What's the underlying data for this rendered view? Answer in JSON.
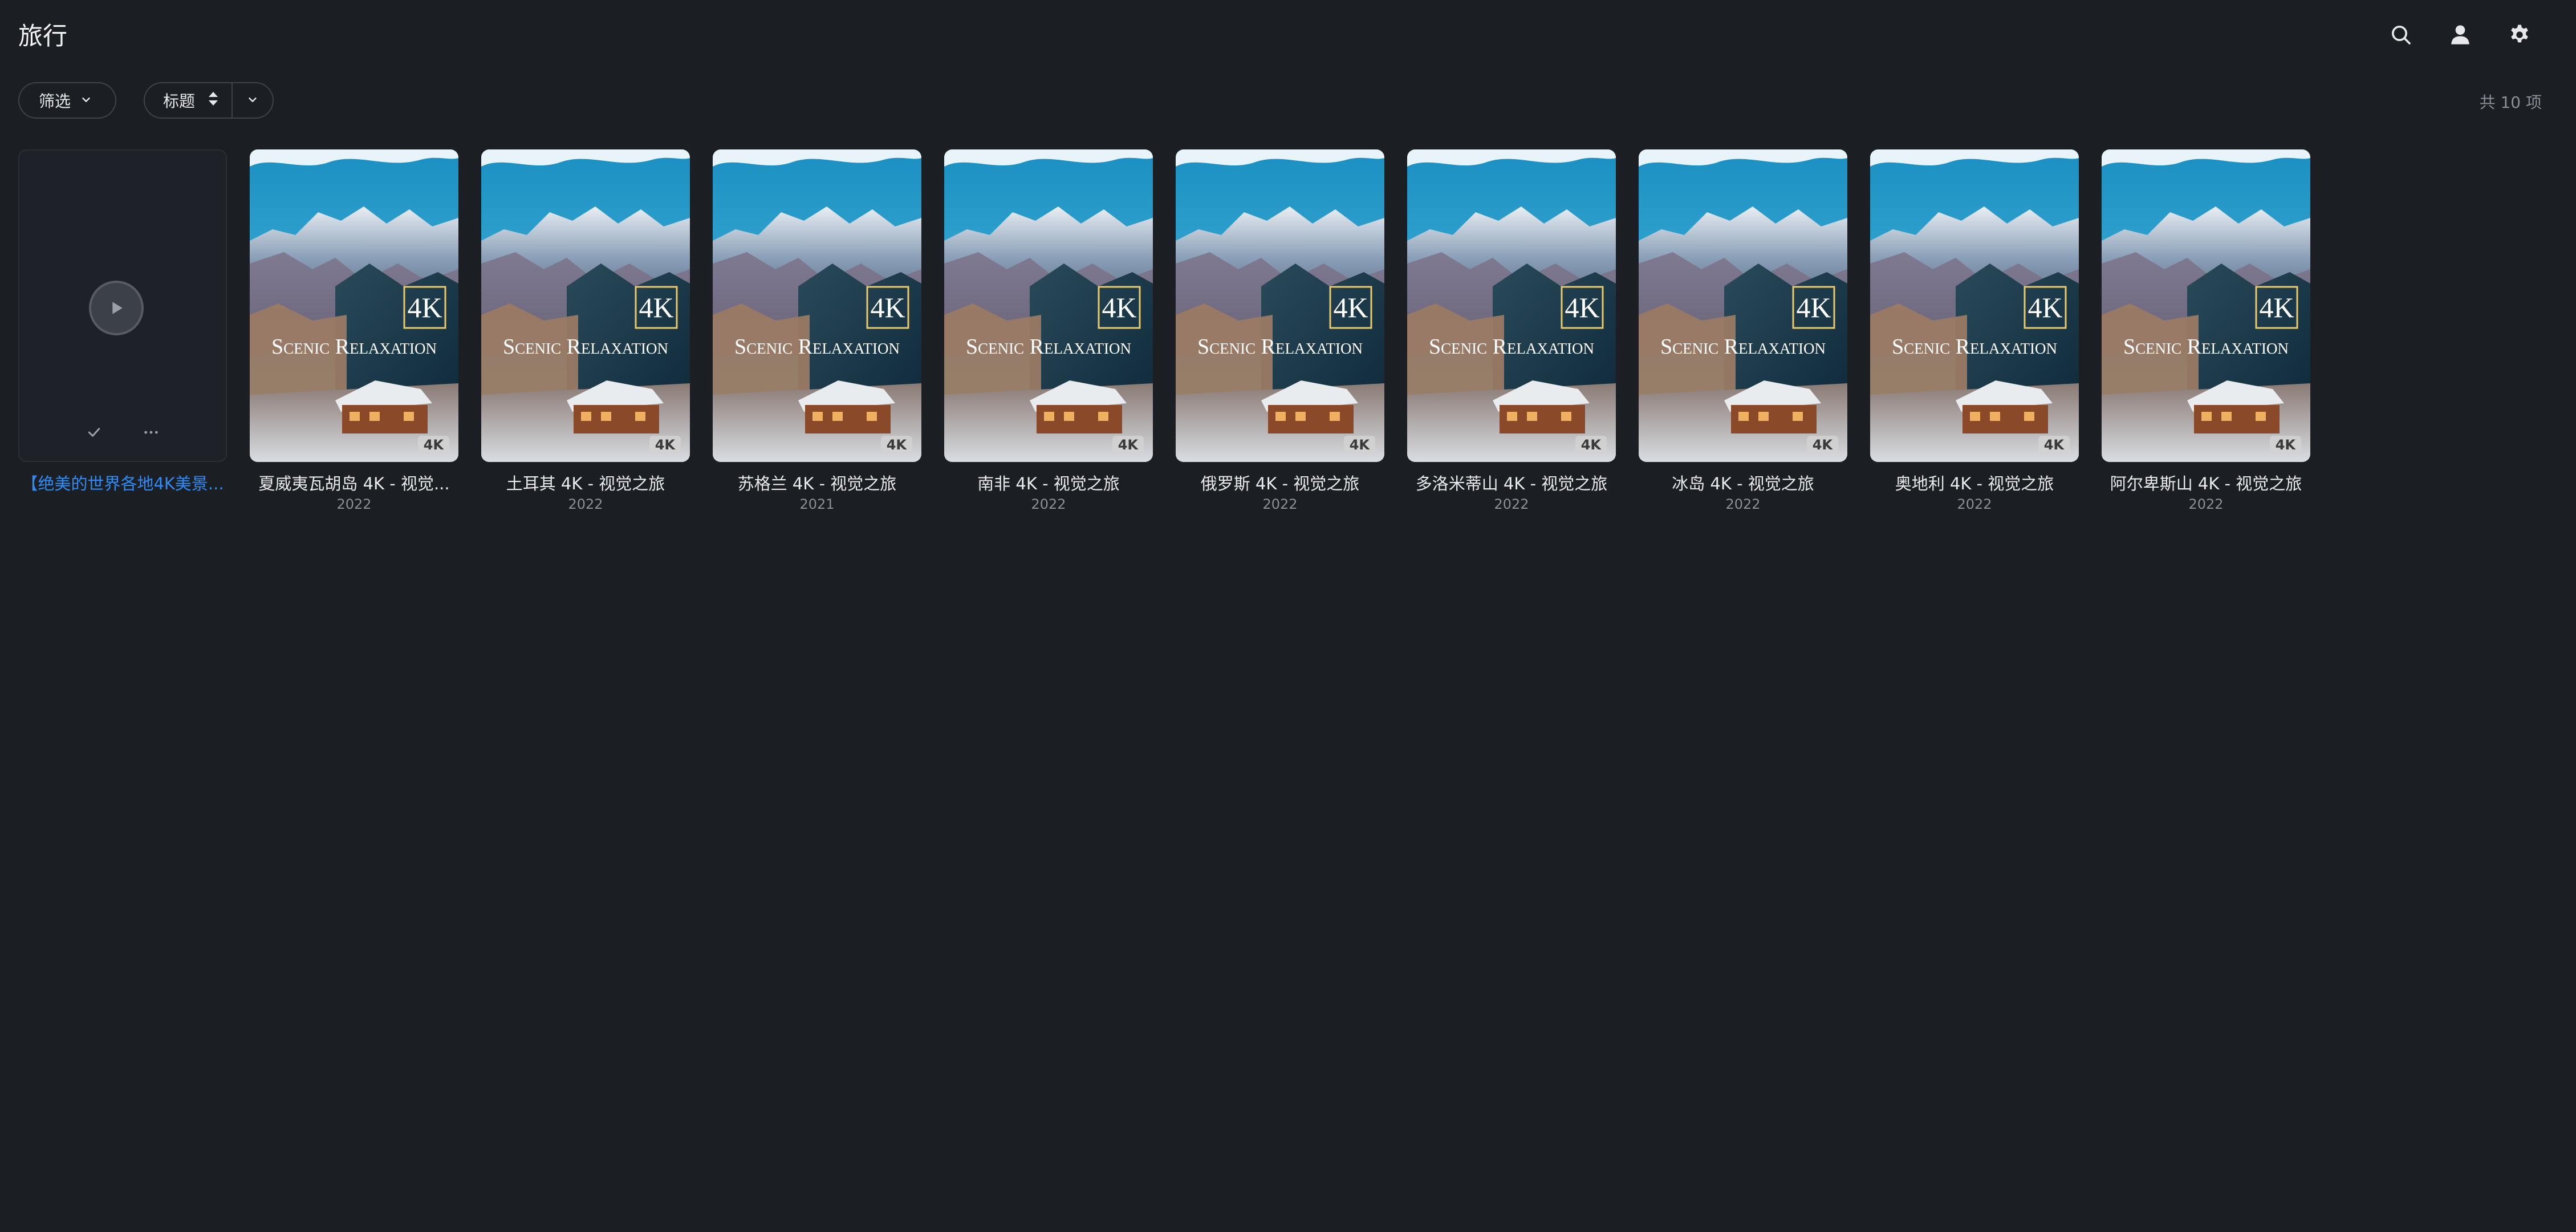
{
  "header": {
    "title": "旅行",
    "icons": [
      "search-icon",
      "user-icon",
      "settings-icon"
    ]
  },
  "toolbar": {
    "filter_label": "筛选",
    "sort_label": "标题",
    "count_text": "共 10 项"
  },
  "poster_art": {
    "badge_text": "4K",
    "logo_4k": "4K",
    "logo_line": "Scenic Relaxation"
  },
  "colors": {
    "background": "#1b1e23",
    "link": "#2f8cf5",
    "muted": "#8a9099"
  },
  "collection": {
    "title": "【绝美的世界各地4K美景...",
    "actions": [
      "check-icon",
      "more-icon"
    ]
  },
  "items": [
    {
      "title": "夏威夷瓦胡岛 4K - 视觉...",
      "year": "2022"
    },
    {
      "title": "土耳其 4K - 视觉之旅",
      "year": "2022"
    },
    {
      "title": "苏格兰 4K - 视觉之旅",
      "year": "2021"
    },
    {
      "title": "南非 4K - 视觉之旅",
      "year": "2022"
    },
    {
      "title": "俄罗斯 4K - 视觉之旅",
      "year": "2022"
    },
    {
      "title": "多洛米蒂山 4K - 视觉之旅",
      "year": "2022"
    },
    {
      "title": "冰岛 4K - 视觉之旅",
      "year": "2022"
    },
    {
      "title": "奥地利 4K - 视觉之旅",
      "year": "2022"
    },
    {
      "title": "阿尔卑斯山 4K - 视觉之旅",
      "year": "2022"
    }
  ]
}
